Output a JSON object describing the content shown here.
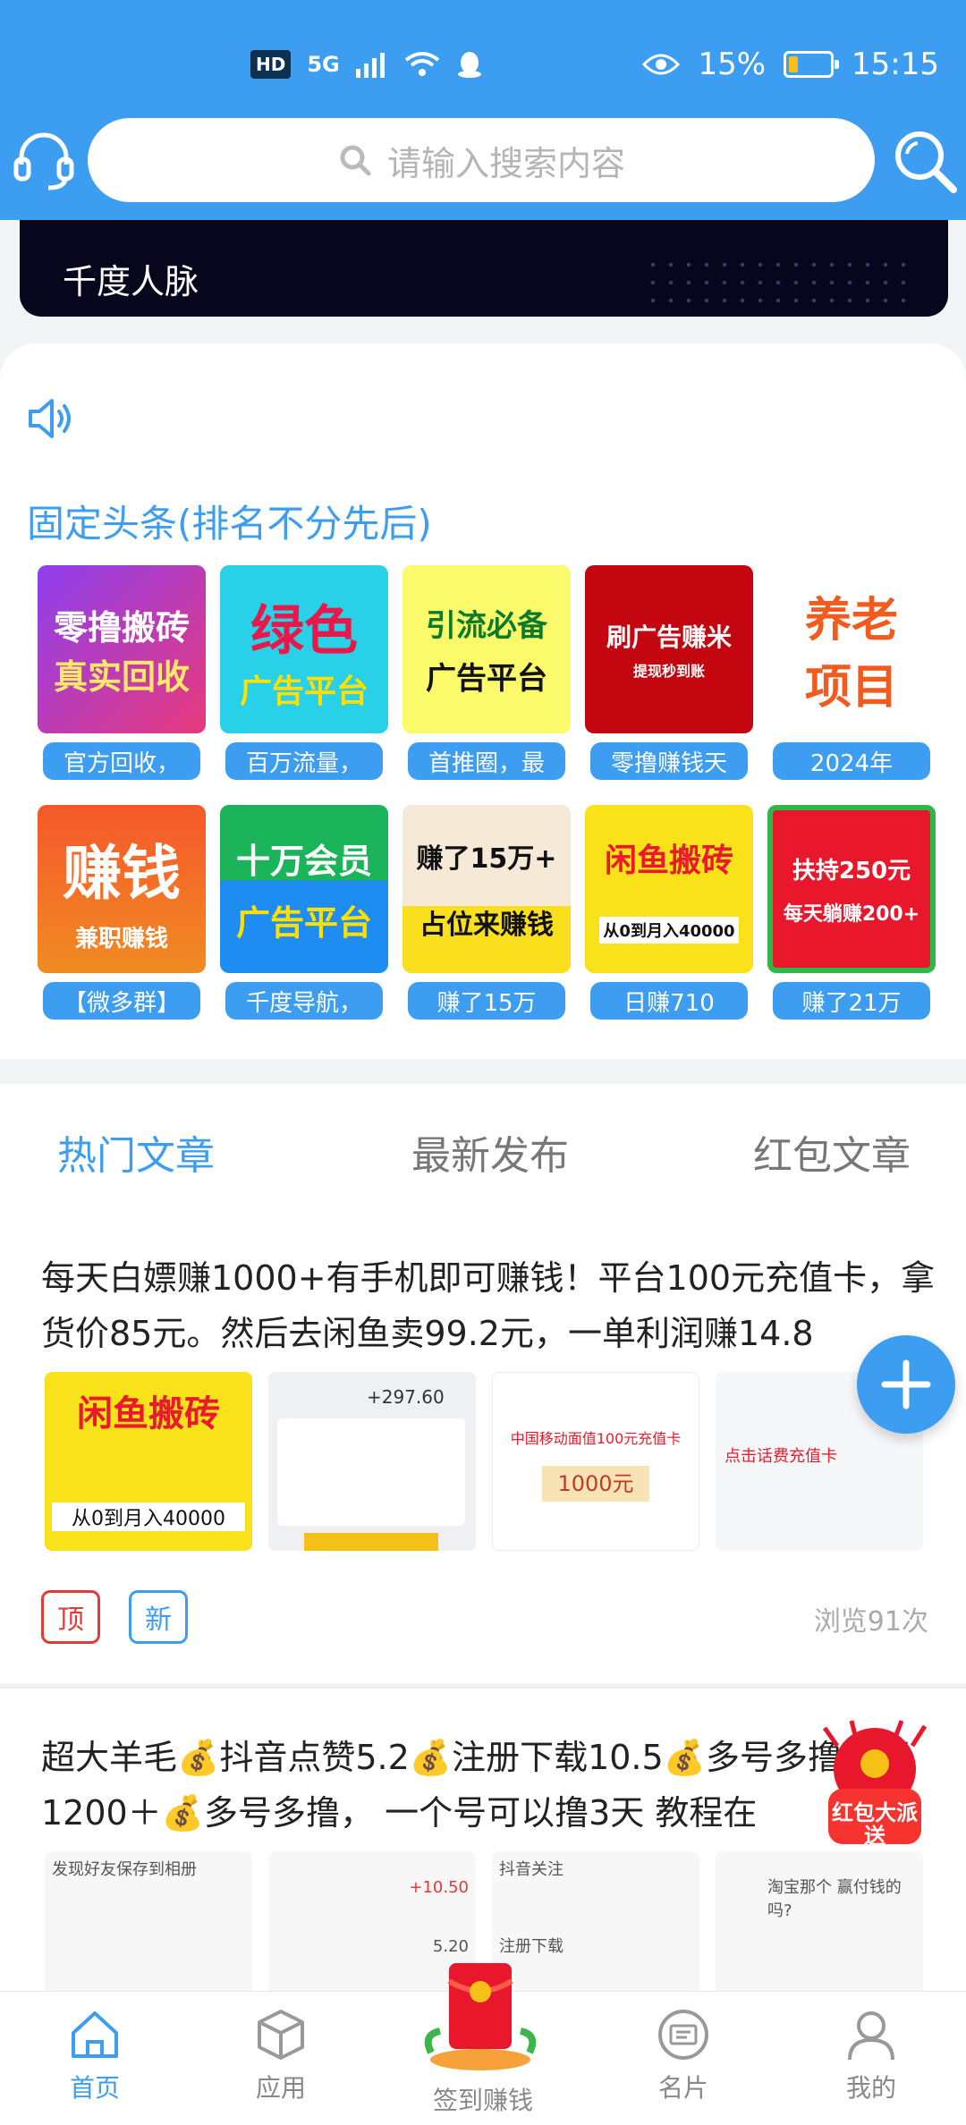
{
  "status_bar": {
    "hd_label": "HD",
    "network": "5G",
    "battery_pct": "15%",
    "time": "15:15"
  },
  "search": {
    "placeholder": "请输入搜索内容"
  },
  "banner": {
    "title": "千度人脉"
  },
  "section": {
    "title": "固定头条(排名不分先后)"
  },
  "tiles": [
    {
      "img_line1": "零撸搬砖",
      "img_line2": "真实回收",
      "label": "官方回收，"
    },
    {
      "img_line1": "绿色",
      "img_line2": "广告平台",
      "label": "百万流量，"
    },
    {
      "img_line1": "引流必备",
      "img_line2": "广告平台",
      "label": "首推圈，最"
    },
    {
      "img_line1": "刷广告赚米",
      "img_line2": "提现秒到账",
      "label": "零撸赚钱天"
    },
    {
      "img_line1": "养老",
      "img_line2": "项目",
      "label": "2024年"
    },
    {
      "img_line1": "赚钱",
      "img_line2": "兼职赚钱",
      "label": "【微多群】"
    },
    {
      "img_line1": "十万会员",
      "img_line2": "广告平台",
      "label": "千度导航，"
    },
    {
      "img_line1": "赚了15万+",
      "img_line2": "占位来赚钱",
      "label": "赚了15万"
    },
    {
      "img_line1": "闲鱼搬砖",
      "img_line2": "从0到月入40000",
      "label": "日赚710"
    },
    {
      "img_line1": "扶持250元",
      "img_line2": "每天躺赚200+",
      "label": "赚了21万"
    }
  ],
  "tabs": [
    "热门文章",
    "最新发布",
    "红包文章"
  ],
  "article1": {
    "title": "每天白嫖赚1000+有手机即可赚钱！平台100元充值卡，拿货价85元。然后去闲鱼卖99.2元，一单利润赚14.8",
    "thumb1_line1": "闲鱼搬砖",
    "thumb1_line2": "从0到月入40000",
    "thumb2_amount": "+297.60",
    "thumb3_line1": "中国移动面值100元充值卡",
    "thumb3_line2": "1000元",
    "thumb4_text": "点击话费充值卡",
    "tag_top": "顶",
    "tag_new": "新",
    "views": "浏览91次"
  },
  "article2": {
    "title": "超大羊毛💰抖音点赞5.2💰注册下载10.5💰多号多撸白嫖1200＋💰多号多撸， 一个号可以撸3天 教程在",
    "t1": "发现好友保存到相册",
    "t2_a": "+10.50",
    "t2_b": "5.20",
    "t3_a": "抖音关注",
    "t3_b": "注册下载",
    "t4": "淘宝那个 赢付钱的吗?"
  },
  "redpack_label": "红包大派送",
  "nav": [
    {
      "label": "首页"
    },
    {
      "label": "应用"
    },
    {
      "label": "签到赚钱"
    },
    {
      "label": "名片"
    },
    {
      "label": "我的"
    }
  ],
  "colors": {
    "primary": "#3d9df1",
    "danger": "#e03a3a"
  }
}
